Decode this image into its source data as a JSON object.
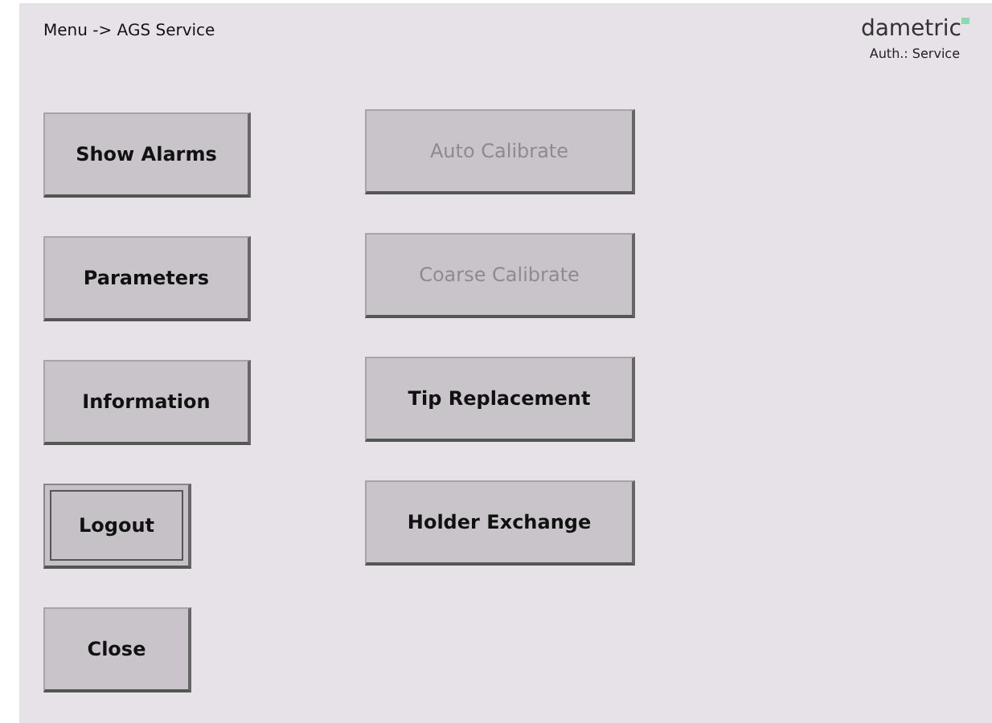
{
  "breadcrumb": "Menu -> AGS Service",
  "logo": {
    "text": "dametric"
  },
  "auth": "Auth.: Service",
  "left_buttons": [
    {
      "label": "Show Alarms",
      "disabled": false,
      "focused": false,
      "kind": "wide"
    },
    {
      "label": "Parameters",
      "disabled": false,
      "focused": false,
      "kind": "wide"
    },
    {
      "label": "Information",
      "disabled": false,
      "focused": false,
      "kind": "wide"
    },
    {
      "label": "Logout",
      "disabled": false,
      "focused": true,
      "kind": "narrow"
    },
    {
      "label": "Close",
      "disabled": false,
      "focused": false,
      "kind": "narrow"
    }
  ],
  "right_buttons": [
    {
      "label": "Auto Calibrate",
      "disabled": true,
      "focused": false,
      "kind": "wide"
    },
    {
      "label": "Coarse Calibrate",
      "disabled": true,
      "focused": false,
      "kind": "wide"
    },
    {
      "label": "Tip Replacement",
      "disabled": false,
      "focused": false,
      "kind": "wide"
    },
    {
      "label": "Holder Exchange",
      "disabled": false,
      "focused": false,
      "kind": "wide"
    }
  ]
}
